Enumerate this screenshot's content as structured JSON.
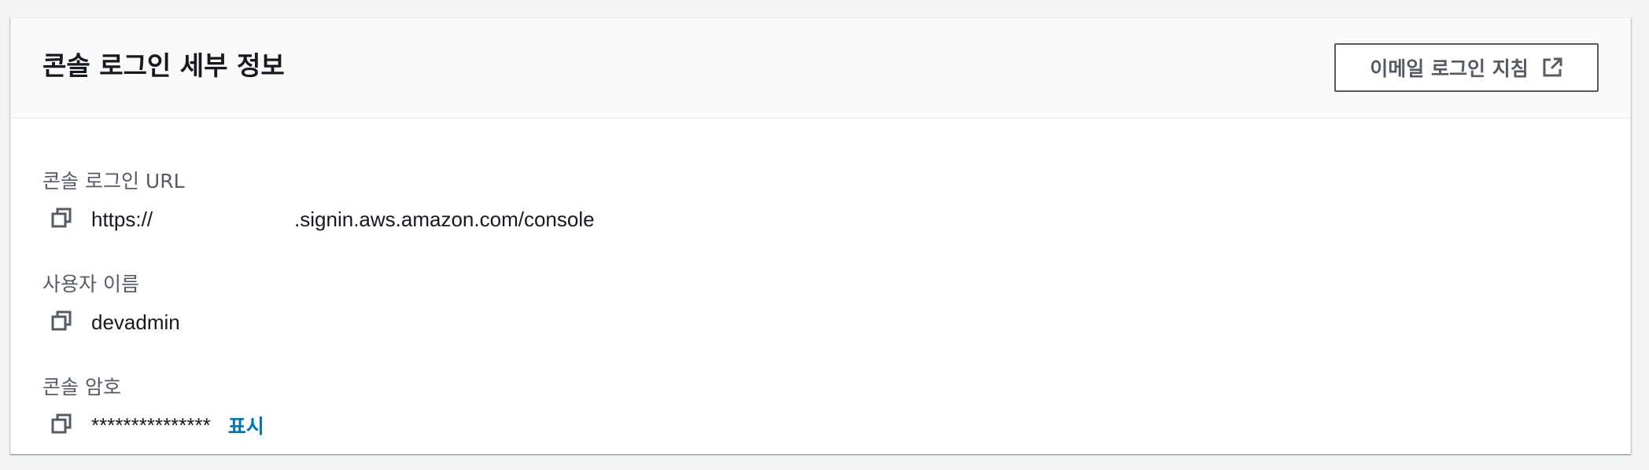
{
  "panel": {
    "title": "콘솔 로그인 세부 정보",
    "email_button_label": "이메일 로그인 지침"
  },
  "fields": {
    "url": {
      "label": "콘솔 로그인 URL",
      "value_prefix": "https://",
      "value_suffix": ".signin.aws.amazon.com/console"
    },
    "username": {
      "label": "사용자 이름",
      "value": "devadmin"
    },
    "password": {
      "label": "콘솔 암호",
      "value": "***************",
      "show_label": "표시"
    }
  },
  "colors": {
    "page_bg": "#f2f3f3",
    "text": "#16191f",
    "label": "#545b64",
    "link": "#0073bb"
  },
  "icons": [
    "external-link-icon",
    "copy-icon"
  ]
}
